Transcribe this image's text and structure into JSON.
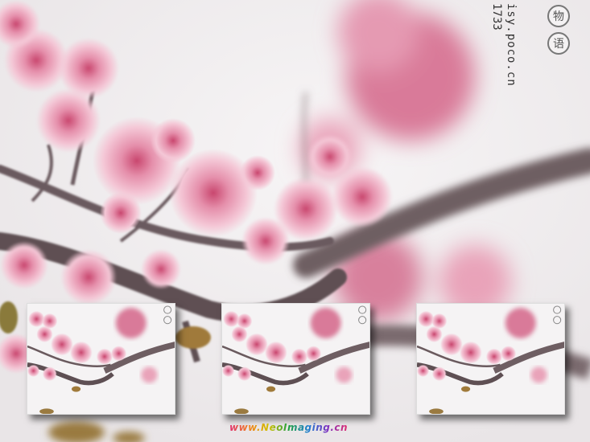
{
  "photo": {
    "subject": "pink cherry blossom branch",
    "colors": {
      "petal": "#e58fab",
      "petal_light": "#f4c7d6",
      "petal_deep": "#c9476f",
      "branch": "#6a5a5e",
      "sky": "#f1eeef"
    }
  },
  "watermark": {
    "vertical_text": "isy.poco.cn",
    "vertical_id": "1733",
    "seals": [
      "物",
      "语"
    ]
  },
  "thumbnails": [
    {
      "name": "thumbnail-1"
    },
    {
      "name": "thumbnail-2"
    },
    {
      "name": "thumbnail-3"
    }
  ],
  "footer": {
    "credit": "www.NeoImaging.cn"
  }
}
